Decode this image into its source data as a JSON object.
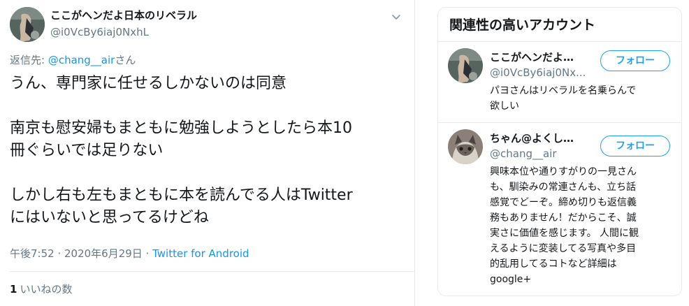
{
  "tweet": {
    "author": {
      "display_name": "ここがヘンだよ日本のリベラル",
      "handle": "@i0VcBy6iaj0NxhL"
    },
    "reply_to": {
      "prefix": "返信先: ",
      "mention": "@chang__air",
      "suffix": "さん"
    },
    "text_lines": [
      "うん、専門家に任せるしかないのは同意",
      "南京も慰安婦もまともに勉強しようとしたら本10",
      "冊ぐらいでは足りない",
      "しかし右も左もまともに本を読んでる人はTwitter",
      "にはいないと思ってるけどね"
    ],
    "timestamp": "午後7:52 · 2020年6月29日 · ",
    "source": "Twitter for Android",
    "likes": {
      "count": "1",
      "label": "いいねの数"
    }
  },
  "related_panel": {
    "title": "関連性の高いアカウント",
    "accounts": [
      {
        "name": "ここがヘンだよ…",
        "handle": "@i0VcBy6iaj0Nx...",
        "follow_label": "フォロー",
        "bio_lines": [
          "パヨさんはリベラルを名乗らんで",
          "欲しい"
        ]
      },
      {
        "name": "ちゃん@よくし…",
        "handle": "@chang__air",
        "follow_label": "フォロー",
        "bio_lines": [
          "興味本位や通りすがりの一見さん",
          "も、馴染みの常連さんも、立ち話",
          "感覚でどーぞ。締め切りも返信義",
          "務もありません！だからこそ、誠",
          "実さに価値を感じます。 人間に観",
          "えるように変装してる写真や多目",
          "的乱用してるコトなど詳細は",
          "google+"
        ]
      }
    ]
  },
  "colors": {
    "accent": "#1da1f2",
    "link": "#1b95e0",
    "secondary_text": "#657786",
    "border": "#e6ecf0"
  },
  "icons": {
    "caret": "chevron-down-icon"
  }
}
